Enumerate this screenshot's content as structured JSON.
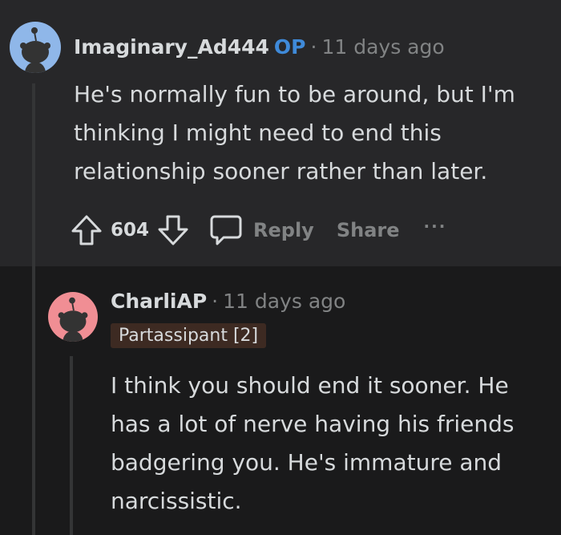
{
  "comment1": {
    "username": "Imaginary_Ad444",
    "op_badge": "OP",
    "separator": "·",
    "timestamp": "11 days ago",
    "body_lines": [
      "He's normally fun to be around, but I'm",
      "thinking I might need to end this",
      "relationship sooner rather than later."
    ],
    "score": "604",
    "reply_label": "Reply",
    "share_label": "Share",
    "more_label": "···",
    "avatar_color": "#8fb7e9"
  },
  "comment2": {
    "username": "CharliAP",
    "separator": "·",
    "timestamp": "11 days ago",
    "flair": "Partassipant [2]",
    "body_lines": [
      "I think you should end it sooner. He",
      "has a lot of nerve having his friends",
      "badgering you. He's immature and",
      "narcissistic."
    ],
    "avatar_color": "#f08e94"
  }
}
